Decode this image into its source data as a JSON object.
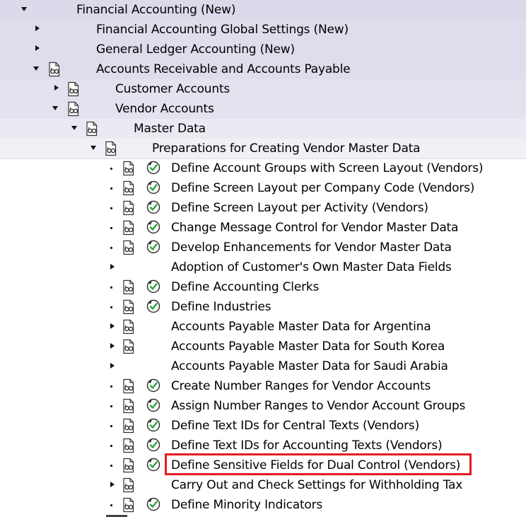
{
  "colors": {
    "level0_bg": "#ddd9ea",
    "level1_bg": "#e0dcec",
    "level2_bg": "#e5e2ef",
    "level3_bg": "#ebe9f2",
    "level4_bg": "#f1f0f6",
    "border": "#c7c1d9",
    "highlight": "#e51c23"
  },
  "tree": {
    "root": {
      "label": "Financial Accounting (New)",
      "state": "expanded"
    },
    "level1": [
      {
        "label": "Financial Accounting Global Settings (New)",
        "state": "collapsed"
      },
      {
        "label": "General Ledger Accounting (New)",
        "state": "collapsed"
      },
      {
        "label": "Accounts Receivable and Accounts Payable",
        "state": "expanded"
      }
    ],
    "level2": [
      {
        "label": "Customer Accounts",
        "state": "collapsed"
      },
      {
        "label": "Vendor Accounts",
        "state": "expanded"
      }
    ],
    "level3": {
      "label": "Master Data",
      "state": "expanded"
    },
    "level4": {
      "label": "Preparations for Creating Vendor Master Data",
      "state": "expanded"
    },
    "activities": [
      {
        "label": "Define Account Groups with Screen Layout (Vendors)",
        "type": "leaf",
        "doc_icon": "documentation-icon",
        "exec_icon": "execute-activity-icon"
      },
      {
        "label": "Define Screen Layout per Company Code (Vendors)",
        "type": "leaf",
        "doc_icon": "documentation-icon",
        "exec_icon": "execute-activity-icon"
      },
      {
        "label": "Define Screen Layout per Activity (Vendors)",
        "type": "leaf",
        "doc_icon": "documentation-icon",
        "exec_icon": "execute-activity-icon"
      },
      {
        "label": "Change Message Control for Vendor Master Data",
        "type": "leaf",
        "doc_icon": "documentation-icon",
        "exec_icon": "execute-activity-icon"
      },
      {
        "label": "Develop Enhancements for Vendor Master Data",
        "type": "leaf",
        "doc_icon": "documentation-icon",
        "exec_icon": "execute-activity-icon"
      },
      {
        "label": "Adoption of Customer's Own Master Data Fields",
        "type": "node"
      },
      {
        "label": "Define Accounting Clerks",
        "type": "leaf",
        "doc_icon": "documentation-icon",
        "exec_icon": "execute-activity-icon"
      },
      {
        "label": "Define Industries",
        "type": "leaf",
        "doc_icon": "documentation-icon",
        "exec_icon": "execute-activity-icon"
      },
      {
        "label": "Accounts Payable Master Data for Argentina",
        "type": "node",
        "doc_icon": "documentation-icon"
      },
      {
        "label": "Accounts Payable Master Data for South Korea",
        "type": "node",
        "doc_icon": "documentation-icon"
      },
      {
        "label": "Accounts Payable Master Data for Saudi Arabia",
        "type": "node"
      },
      {
        "label": "Create Number Ranges for Vendor Accounts",
        "type": "leaf",
        "doc_icon": "documentation-icon",
        "exec_icon": "execute-activity-icon"
      },
      {
        "label": "Assign Number Ranges to Vendor Account Groups",
        "type": "leaf",
        "doc_icon": "documentation-icon",
        "exec_icon": "execute-activity-icon"
      },
      {
        "label": "Define Text IDs for Central Texts (Vendors)",
        "type": "leaf",
        "doc_icon": "documentation-icon",
        "exec_icon": "execute-activity-icon"
      },
      {
        "label": "Define Text IDs for Accounting Texts (Vendors)",
        "type": "leaf",
        "doc_icon": "documentation-icon",
        "exec_icon": "execute-activity-icon"
      },
      {
        "label": "Define Sensitive Fields for Dual Control (Vendors)",
        "type": "leaf",
        "doc_icon": "documentation-icon",
        "exec_icon": "execute-activity-icon",
        "highlighted": true
      },
      {
        "label": "Carry Out and Check Settings for Withholding Tax",
        "type": "node",
        "doc_icon": "documentation-icon"
      },
      {
        "label": "Define Minority Indicators",
        "type": "leaf",
        "doc_icon": "documentation-icon",
        "exec_icon": "execute-activity-icon"
      }
    ]
  }
}
